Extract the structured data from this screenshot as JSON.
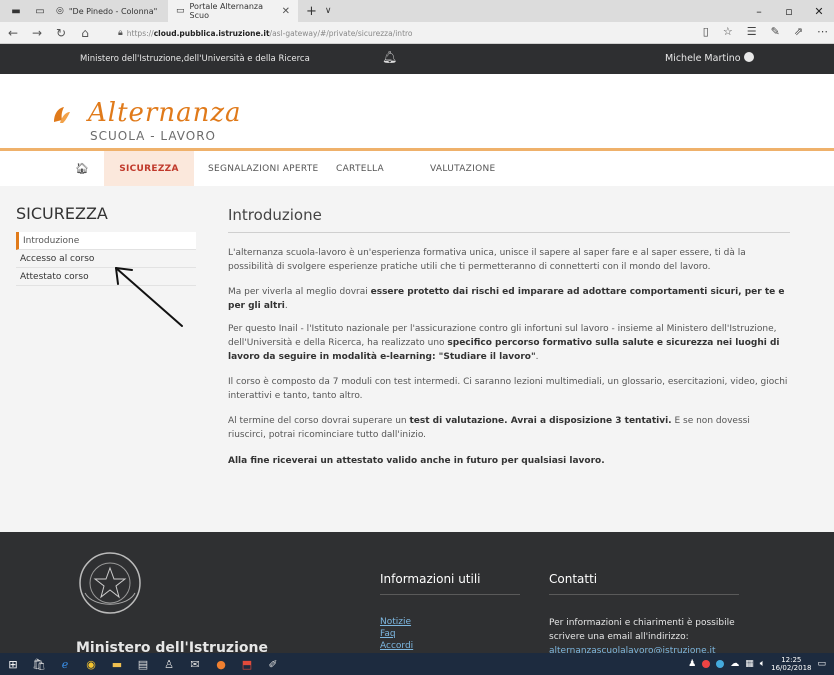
{
  "browser": {
    "tabs": [
      {
        "label": "\"De Pinedo - Colonna\"",
        "active": false
      },
      {
        "label": "Portale Alternanza Scuo",
        "active": true
      }
    ],
    "address": {
      "prefix": "https://",
      "domain": "cloud.pubblica.istruzione.it",
      "path": "/asl-gateway/#/private/sicurezza/intro"
    }
  },
  "topbar": {
    "ministry": "Ministero dell'Istruzione,dell'Università e della Ricerca",
    "user": "Michele Martino"
  },
  "logo": {
    "script": "Alternanza",
    "sub": "SCUOLA - LAVORO",
    "color": "#e07a1a"
  },
  "menu": {
    "items": [
      "SICUREZZA",
      "SEGNALAZIONI APERTE",
      "CARTELLA",
      "VALUTAZIONE"
    ],
    "active": "SICUREZZA"
  },
  "sidebar": {
    "title": "SICUREZZA",
    "items": [
      "Introduzione",
      "Accesso al corso",
      "Attestato corso"
    ]
  },
  "main": {
    "title": "Introduzione",
    "p1": "L'alternanza scuola-lavoro è un'esperienza formativa unica, unisce il sapere al saper fare e al saper essere, ti dà la possibilità di svolgere esperienze pratiche utili che ti permetteranno di connetterti con il mondo del lavoro.",
    "p2a": "Ma per viverla al meglio dovrai ",
    "p2b": "essere protetto dai rischi ed imparare ad adottare comportamenti sicuri, per te e per gli altri",
    "p2c": ".",
    "p3a": "Per questo Inail - l'Istituto nazionale per l'assicurazione contro gli infortuni sul lavoro - insieme al Ministero dell'Istruzione, dell'Università e della Ricerca, ha realizzato uno ",
    "p3b": "specifico percorso formativo sulla salute e sicurezza nei luoghi di lavoro da seguire in modalità e-learning: \"Studiare il lavoro\"",
    "p3c": ".",
    "p4": "Il corso è composto da 7 moduli con test intermedi. Ci saranno lezioni multimediali, un glossario, esercitazioni, video, giochi interattivi e tanto, tanto altro.",
    "p5a": "Al termine del corso dovrai superare un ",
    "p5b": "test di valutazione. Avrai a disposizione 3 tentativi.",
    "p5c": " E se non dovessi riuscirci, potrai ricominciare tutto dall'inizio.",
    "p6": "Alla fine riceverai un attestato valido anche in futuro per qualsiasi lavoro."
  },
  "footer": {
    "brand": "Ministero dell'Istruzione",
    "info_title": "Informazioni utili",
    "links": [
      "Notizie",
      "Faq",
      "Accordi"
    ],
    "contact_title": "Contatti",
    "contact_text": "Per informazioni e chiarimenti è possibile scrivere una email all'indirizzo:",
    "contact_email": "alternanzascuolalavoro@istruzione.it"
  },
  "taskbar": {
    "time": "12:25",
    "date": "16/02/2018"
  }
}
